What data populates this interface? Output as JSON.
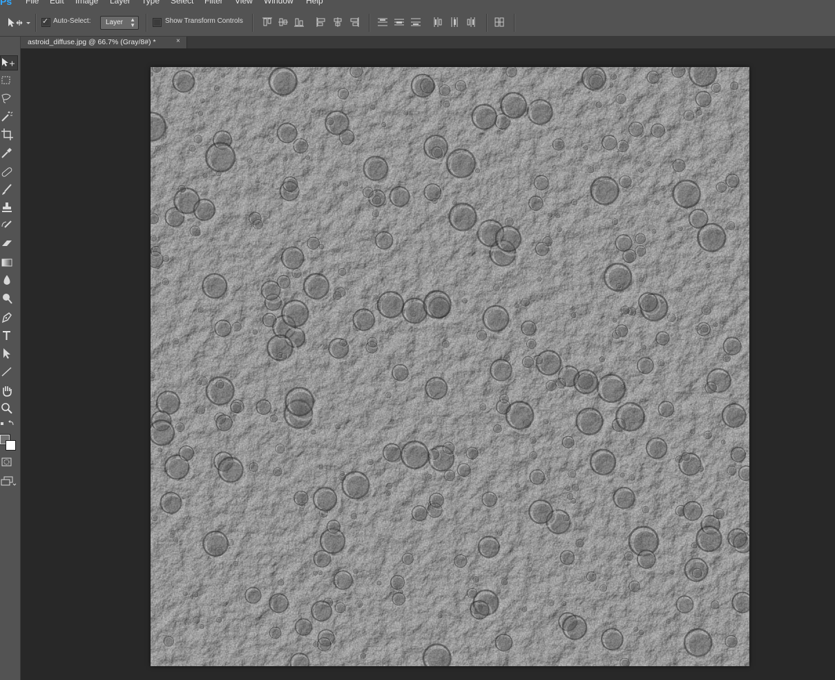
{
  "app": {
    "logo": "Ps"
  },
  "menu": [
    "File",
    "Edit",
    "Image",
    "Layer",
    "Type",
    "Select",
    "Filter",
    "View",
    "Window",
    "Help"
  ],
  "options": {
    "tool_icon": "move-tool-icon",
    "auto_select_label": "Auto-Select:",
    "auto_select_checked": true,
    "auto_select_target": "Layer",
    "show_transform_label": "Show Transform Controls",
    "show_transform_checked": false
  },
  "document": {
    "tab_title": "astroid_diffuse.jpg @ 66.7% (Gray/8#) *",
    "close_symbol": "×"
  },
  "tools": [
    "move-tool",
    "marquee-tool",
    "lasso-tool",
    "magic-wand-tool",
    "crop-tool",
    "eyedropper-tool",
    "healing-brush-tool",
    "brush-tool",
    "clone-stamp-tool",
    "history-brush-tool",
    "eraser-tool",
    "gradient-tool",
    "blur-tool",
    "dodge-tool",
    "pen-tool",
    "type-tool",
    "path-selection-tool",
    "line-tool",
    "hand-tool",
    "zoom-tool"
  ],
  "colors": {
    "foreground": "#727272",
    "background": "#ffffff",
    "ui_panel": "#535353",
    "workspace": "#282828"
  },
  "canvas": {
    "content": "grayscale cratered asteroid surface texture"
  }
}
